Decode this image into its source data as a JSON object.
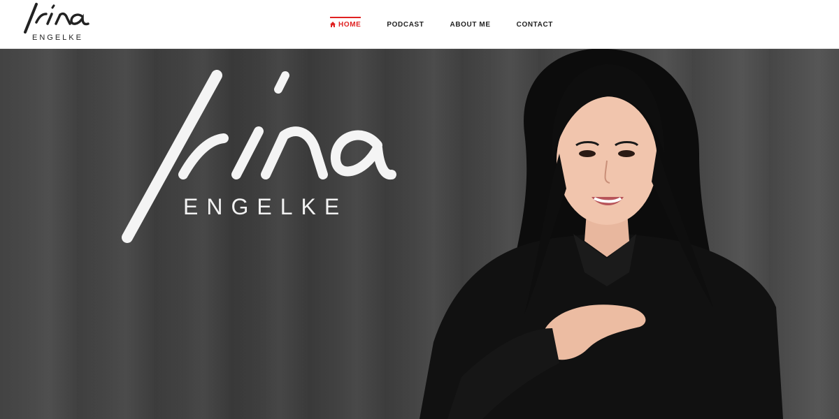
{
  "brand": {
    "name_script": "Irina",
    "name_sub": "ENGELKE"
  },
  "nav": {
    "items": [
      {
        "label": "HOME",
        "active": true,
        "icon": "home-icon"
      },
      {
        "label": "PODCAST",
        "active": false
      },
      {
        "label": "ABOUT ME",
        "active": false
      },
      {
        "label": "CONTACT",
        "active": false
      }
    ]
  },
  "hero": {
    "logo_script": "Irina",
    "logo_sub": "ENGELKE"
  },
  "colors": {
    "accent": "#e02222",
    "nav_text": "#222222",
    "hero_bg": "#464646",
    "hero_text": "#f2f2f2"
  }
}
